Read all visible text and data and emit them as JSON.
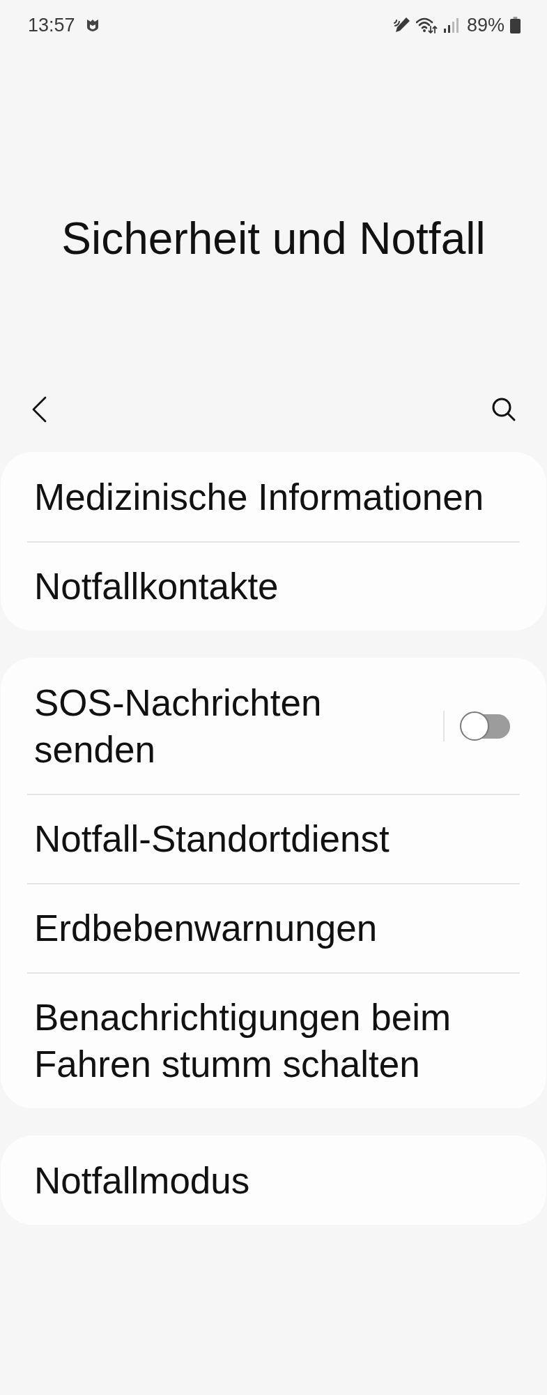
{
  "status_bar": {
    "time": "13:57",
    "battery": "89%"
  },
  "title": "Sicherheit und Notfall",
  "groups": [
    {
      "items": [
        {
          "kind": "link",
          "label": "Medizinische Informationen"
        },
        {
          "kind": "link",
          "label": "Notfallkontakte"
        }
      ]
    },
    {
      "items": [
        {
          "kind": "switch",
          "label": "SOS-Nachrichten senden",
          "on": false
        },
        {
          "kind": "link",
          "label": "Notfall-Standortdienst"
        },
        {
          "kind": "link",
          "label": "Erdbebenwarnungen"
        },
        {
          "kind": "link",
          "label": "Benachrichtigungen beim Fahren stumm schalten"
        }
      ]
    },
    {
      "items": [
        {
          "kind": "link",
          "label": "Notfallmodus"
        }
      ]
    }
  ]
}
